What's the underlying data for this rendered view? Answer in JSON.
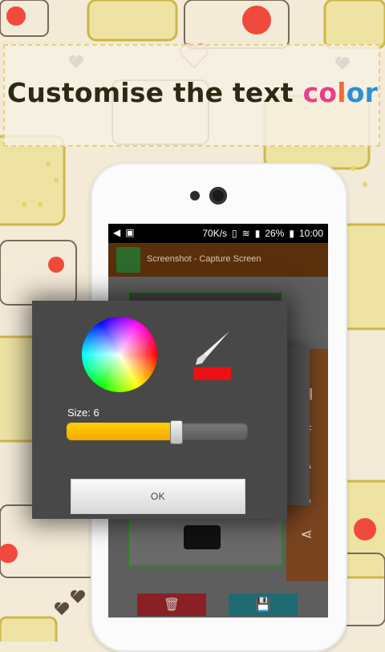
{
  "headline": {
    "prefix": "Customise the text ",
    "accent_letters": [
      {
        "ch": "c",
        "color": "#e83f8a"
      },
      {
        "ch": "o",
        "color": "#e83f8a"
      },
      {
        "ch": "l",
        "color": "#f06a3a"
      },
      {
        "ch": "o",
        "color": "#2d8ed6"
      },
      {
        "ch": "r",
        "color": "#2d8ed6"
      }
    ]
  },
  "status_bar": {
    "network_speed": "70K/s",
    "battery": "26%",
    "time": "10:00"
  },
  "app_bar": {
    "title": "Screenshot - Capture Screen",
    "icon": "phone-icon"
  },
  "dialog": {
    "size_label": "Size: 6",
    "size_value": 6,
    "slider_fraction": 0.6,
    "swatch_color": "#ee0f14",
    "ok_label": "OK"
  },
  "bottom_buttons": {
    "delete_icon": "trash-icon",
    "save_icon": "floppy-icon"
  },
  "colors": {
    "app_bar": "#5a2f0c",
    "side_panel": "#7a4420",
    "delete": "#8a1f24",
    "save": "#1f6b74",
    "slider_fill": "#f4a900"
  }
}
